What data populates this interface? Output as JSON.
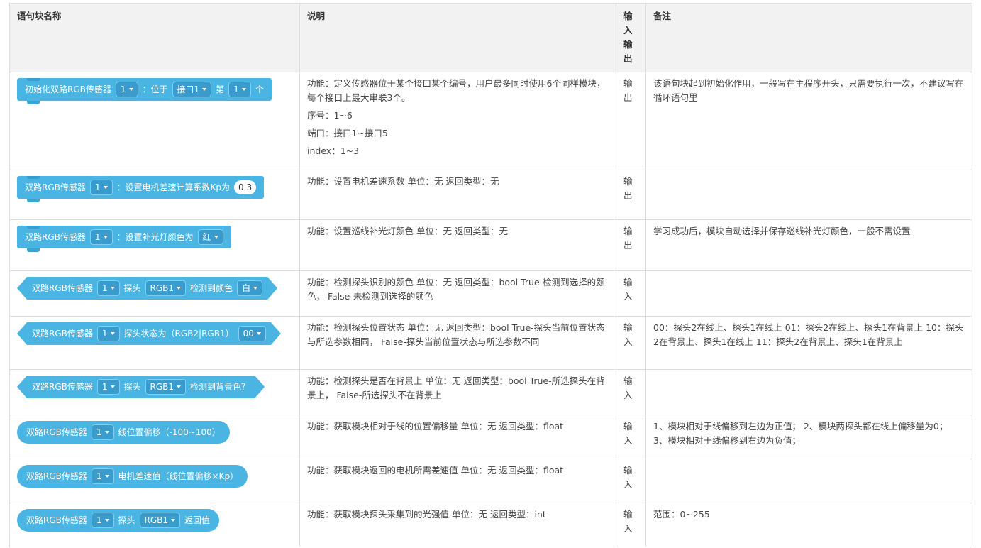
{
  "headers": {
    "name": "语句块名称",
    "desc": "说明",
    "io": "输入输出",
    "note": "备注"
  },
  "colors": {
    "block": "#4ab4e2",
    "dropdown": "#3a9ccc",
    "header_bg": "#f2f2f2",
    "border": "#dcdcdc"
  },
  "rows": [
    {
      "block": {
        "type": "command",
        "parts": [
          "初始化双路RGB传感器",
          "1",
          "：位于",
          "接口1",
          "第",
          "1",
          "个"
        ]
      },
      "desc": [
        "功能：定义传感器位于某个接口某个编号，用户最多同时使用6个同样模块，每个接口上最大串联3个。",
        "序号：1~6",
        "端口：接口1~接口5",
        "index：1~3"
      ],
      "io": "输出",
      "note": " 该语句块起到初始化作用，一般写在主程序开头，只需要执行一次，不建议写在循环语句里"
    },
    {
      "block": {
        "type": "command",
        "parts": [
          "双路RGB传感器",
          "1",
          "：设置电机差速计算系数Kp为",
          "0.3"
        ]
      },
      "desc": [
        "功能：设置电机差速系数 单位：无   返回类型：无"
      ],
      "io": "输出",
      "note": ""
    },
    {
      "block": {
        "type": "command",
        "parts": [
          "双路RGB传感器",
          "1",
          "：设置补光灯颜色为",
          "红"
        ]
      },
      "desc": [
        "功能：设置巡线补光灯颜色 单位：无   返回类型：无"
      ],
      "io": "输出",
      "note": "学习成功后，模块自动选择并保存巡线补光灯颜色，一般不需设置"
    },
    {
      "block": {
        "type": "boolean",
        "parts": [
          "双路RGB传感器",
          "1",
          "探头",
          "RGB1",
          "检测到颜色",
          "白"
        ]
      },
      "desc": [
        "功能：检测探头识别的颜色 单位：无   返回类型：bool True-检测到选择的颜色， False-未检测到选择的颜色"
      ],
      "io": "输入",
      "note": ""
    },
    {
      "block": {
        "type": "boolean",
        "parts": [
          "双路RGB传感器",
          "1",
          "探头状态为（RGB2|RGB1）",
          "00"
        ]
      },
      "desc": [
        "功能：检测探头位置状态 单位：无   返回类型：bool True-探头当前位置状态与所选参数相同， False-探头当前位置状态与所选参数不同"
      ],
      "io": "输入",
      "note": "00：探头2在线上、探头1在线上 01：探头2在线上、探头1在背景上 10：探头2在背景上、探头1在线上 11：探头2在背景上、探头1在背景上"
    },
    {
      "block": {
        "type": "boolean",
        "parts": [
          "双路RGB传感器",
          "1",
          "探头",
          "RGB1",
          "检测到背景色？"
        ]
      },
      "desc": [
        "功能：检测探头是否在背景上 单位：无   返回类型：bool True-所选探头在背景上， False-所选探头不在背景上"
      ],
      "io": "输入",
      "note": ""
    },
    {
      "block": {
        "type": "reporter",
        "parts": [
          "双路RGB传感器",
          "1",
          "线位置偏移（-100~100）"
        ]
      },
      "desc": [
        "功能：获取模块相对于线的位置偏移量 单位：无 返回类型：float"
      ],
      "io": "输入",
      "note": "1、模块相对于线偏移到左边为正值； 2、模块两探头都在线上偏移量为0； 3、模块相对于线偏移到右边为负值；"
    },
    {
      "block": {
        "type": "reporter",
        "parts": [
          "双路RGB传感器",
          "1",
          "电机差速值（线位置偏移×Kp）"
        ]
      },
      "desc": [
        "功能：获取模块返回的电机所需差速值  单位：无 返回类型：float"
      ],
      "io": "输入",
      "note": ""
    },
    {
      "block": {
        "type": "reporter",
        "parts": [
          "双路RGB传感器",
          "1",
          "探头",
          "RGB1",
          "返回值"
        ]
      },
      "desc": [
        "功能：获取模块探头采集到的光强值  单位：无 返回类型：int"
      ],
      "io": "输入",
      "note": "范围：0~255"
    }
  ]
}
